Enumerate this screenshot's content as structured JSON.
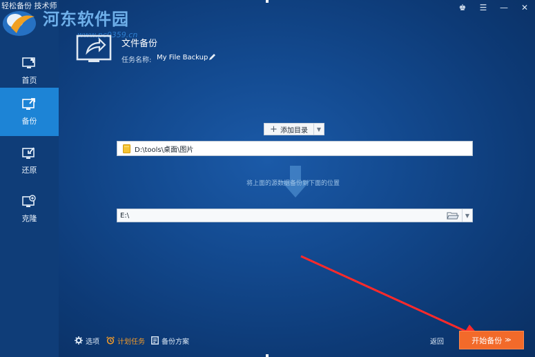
{
  "app": {
    "title": "轻松备份 技术师"
  },
  "watermark": {
    "site_name": "河东软件园",
    "url": "www.pc0359.cn"
  },
  "window_controls": {
    "pin": "♚",
    "menu": "☰",
    "minimize": "—",
    "close": "✕"
  },
  "sidebar": {
    "items": [
      {
        "label": "首页",
        "icon": "home-monitor-icon",
        "active": false
      },
      {
        "label": "备份",
        "icon": "backup-monitor-icon",
        "active": true
      },
      {
        "label": "还原",
        "icon": "restore-monitor-icon",
        "active": false
      },
      {
        "label": "克隆",
        "icon": "clone-monitor-icon",
        "active": false
      }
    ]
  },
  "header": {
    "title": "文件备份",
    "task_name_label": "任务名称:",
    "task_name_value": "My File Backup"
  },
  "source": {
    "add_button_label": "添加目录",
    "path": "D:\\tools\\桌面\\图片"
  },
  "hint": {
    "text": "将上面的源数据备份到下面的位置"
  },
  "destination": {
    "path": "E:\\"
  },
  "bottom_bar": {
    "options_label": "选项",
    "schedule_label": "计划任务",
    "scheme_label": "备份方案",
    "back_label": "返回",
    "start_label": "开始备份",
    "start_caret": "≫"
  },
  "colors": {
    "background": "#134a90",
    "sidebar": "#0f3d78",
    "active_nav": "#1d84d6",
    "accent_orange": "#f26a2a",
    "schedule_highlight": "#f29b2a",
    "annotation_red": "#ff2a2a"
  }
}
